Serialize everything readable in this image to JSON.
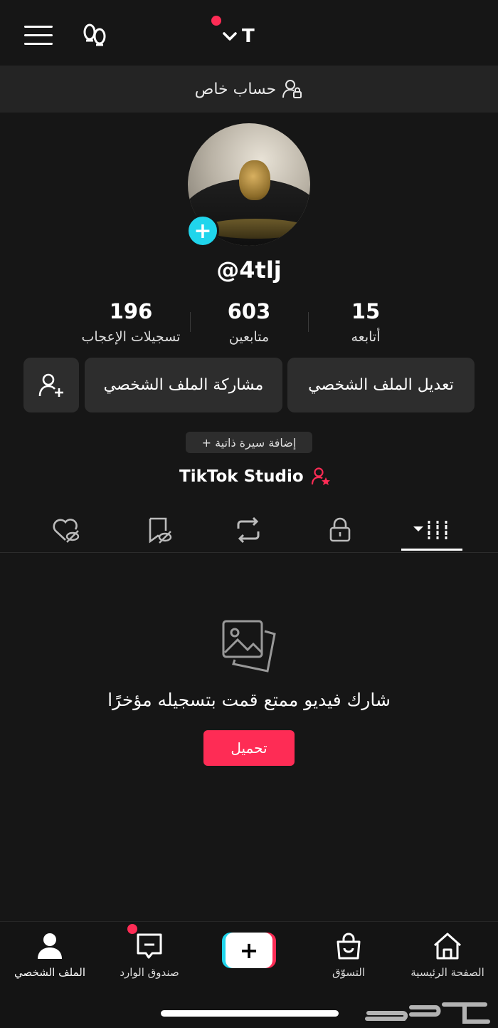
{
  "header": {
    "account_letter": "T",
    "menu_icon": "hamburger-icon",
    "footprint_icon": "footprint-icon",
    "switch_icon": "chevron-down-icon"
  },
  "banner": {
    "text": "حساب خاص",
    "icon": "private-account-icon"
  },
  "profile": {
    "username": "@4tlj",
    "add_icon": "plus-icon"
  },
  "stats": [
    {
      "value": "15",
      "label": "أتابعه"
    },
    {
      "value": "603",
      "label": "متابعين"
    },
    {
      "value": "196",
      "label": "تسجيلات الإعجاب"
    }
  ],
  "actions": {
    "edit_profile": "تعديل الملف الشخصي",
    "share_profile": "مشاركة الملف الشخصي",
    "add_friend_icon": "add-user-icon"
  },
  "bio_button": "+ إضافة سيرة ذاتية",
  "studio": {
    "label": "TikTok Studio",
    "icon": "user-star-icon"
  },
  "tabs": [
    "videos-grid-icon",
    "lock-icon",
    "repost-icon",
    "bookmark-hidden-icon",
    "liked-hidden-icon"
  ],
  "empty_state": {
    "icon": "photos-icon",
    "message": "شارك فيديو ممتع قمت بتسجيله مؤخرًا",
    "button": "تحميل"
  },
  "bottom_nav": {
    "home": "الصفحة الرئيسية",
    "shop": "التسوّق",
    "create_icon": "plus-icon",
    "inbox": "صندوق الوارد",
    "profile": "الملف الشخصي"
  },
  "watermark": "حراج",
  "colors": {
    "accent": "#fe2c55",
    "cyan": "#20d5ec",
    "background": "#161616"
  }
}
